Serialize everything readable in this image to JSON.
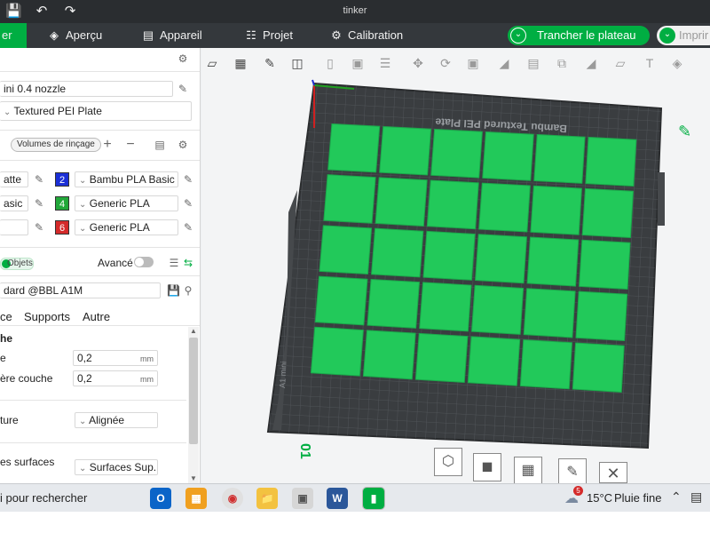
{
  "titlebar": {
    "title": "tinker"
  },
  "tabs": {
    "prepare": "er",
    "preview": "Aperçu",
    "device": "Appareil",
    "project": "Projet",
    "calibration": "Calibration",
    "slice_button": "Trancher le plateau",
    "print_button": "Imprir"
  },
  "printer": {
    "nozzle": "ini 0.4 nozzle",
    "plate": "Textured PEI Plate"
  },
  "filament": {
    "flush_button": "Volumes de rinçage",
    "slots": [
      {
        "left_text": "atte",
        "num": "2",
        "num_color": "#1b2fd6",
        "name": "Bambu PLA Basic"
      },
      {
        "left_text": "asic",
        "num": "4",
        "num_color": "#22a83a",
        "name": "Generic PLA"
      },
      {
        "left_text": "",
        "num": "6",
        "num_color": "#d42a2a",
        "name": "Generic PLA"
      }
    ]
  },
  "process": {
    "objects_toggle": "Objets",
    "advanced_label": "Avancé",
    "preset": "dard @BBL A1M",
    "subtabs": [
      "ce",
      "Supports",
      "Autre"
    ],
    "section": "he",
    "layer_height_label": "e",
    "layer_height": "0,2",
    "first_layer_label": "ère couche",
    "first_layer": "0,2",
    "unit": "mm",
    "seam_label": "ture",
    "seam_value": "Alignée",
    "surface_label": "es surfaces",
    "surface_value": "Surfaces Sup."
  },
  "plate": {
    "title_text": "Bambu Textured PEI Plate",
    "number_label": "01",
    "side_text": "A1 mini"
  },
  "taskbar": {
    "search": "i pour rechercher",
    "weather_temp": "15°C",
    "weather_desc": "Pluie fine",
    "notification_count": "5"
  },
  "colors": {
    "accent": "#00ae42",
    "tile": "#22c95a",
    "bed": "#3a3d40"
  }
}
